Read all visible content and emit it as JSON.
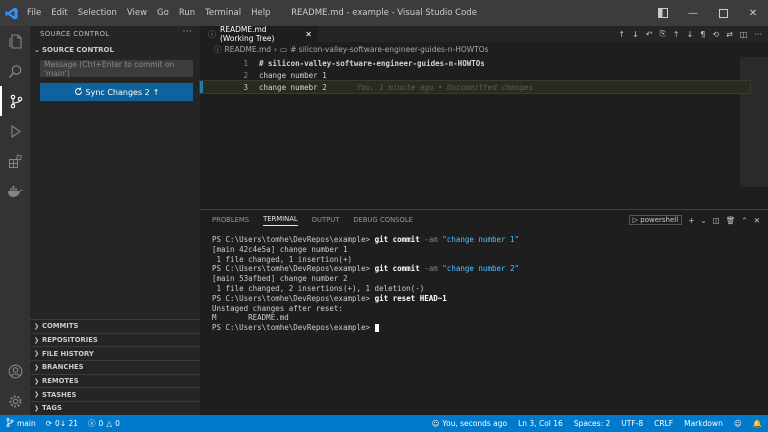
{
  "window": {
    "title": "README.md - example - Visual Studio Code",
    "menu": [
      "File",
      "Edit",
      "Selection",
      "View",
      "Go",
      "Run",
      "Terminal",
      "Help"
    ]
  },
  "sidebar": {
    "header": "SOURCE CONTROL",
    "section_title": "SOURCE CONTROL",
    "commit_placeholder": "Message (Ctrl+Enter to commit on 'main')",
    "sync_label": "Sync Changes 2",
    "collapsed_sections": [
      "COMMITS",
      "REPOSITORIES",
      "FILE HISTORY",
      "BRANCHES",
      "REMOTES",
      "STASHES",
      "TAGS"
    ]
  },
  "editor": {
    "tab_label": "README.md (Working Tree)",
    "breadcrumb_file": "README.md",
    "breadcrumb_symbol": "# silicon-valley-software-engineer-guides-n-HOWTOs",
    "lines": [
      {
        "num": "1",
        "text": "# silicon-valley-software-engineer-guides-n-HOWTOs"
      },
      {
        "num": "2",
        "text": "change number 1"
      },
      {
        "num": "3",
        "text": "change numebr 2",
        "blame": "You, 1 minute ago • Uncommitted changes"
      }
    ]
  },
  "panel": {
    "tabs": [
      "PROBLEMS",
      "TERMINAL",
      "OUTPUT",
      "DEBUG CONSOLE"
    ],
    "active_tab": "TERMINAL",
    "shell": "powershell",
    "terminal": {
      "prompt": "PS C:\\Users\\tomhe\\DevRepos\\example>",
      "cmd1_git": "git commit",
      "cmd1_flag": "-am",
      "cmd1_msg": "\"change number 1\"",
      "out1": "[main 42c4e5a] change number 1",
      "out2": " 1 file changed, 1 insertion(+)",
      "cmd2_git": "git commit",
      "cmd2_flag": "-am",
      "cmd2_msg": "\"change number 2\"",
      "out3": "[main 53afbed] change number 2",
      "out4": " 1 file changed, 2 insertions(+), 1 deletion(-)",
      "cmd3": "git reset HEAD~1",
      "out5": "Unstaged changes after reset:",
      "out6": "M       README.md"
    }
  },
  "statusbar": {
    "branch": "main",
    "sync": "0↓ 21",
    "errors": "0",
    "warnings": "0",
    "blame": "You, seconds ago",
    "position": "Ln 3, Col 16",
    "spaces": "Spaces: 2",
    "encoding": "UTF-8",
    "eol": "CRLF",
    "language": "Markdown"
  },
  "colors": {
    "accent": "#007acc",
    "button": "#0e639c"
  }
}
